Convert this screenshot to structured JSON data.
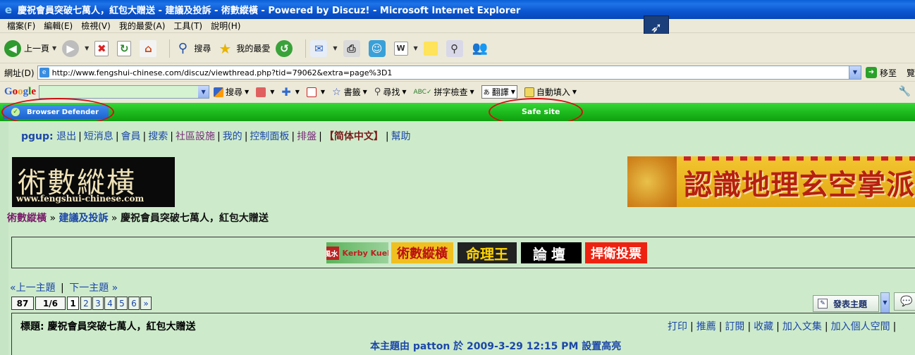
{
  "window": {
    "title": "慶祝會員突破七萬人，紅包大贈送 - 建議及投訴 - 術數縱橫 - Powered by Discuz! - Microsoft Internet Explorer"
  },
  "menu": [
    "檔案(F)",
    "編輯(E)",
    "檢視(V)",
    "我的最愛(A)",
    "工具(T)",
    "說明(H)"
  ],
  "toolbar": {
    "back_label": "上一頁",
    "search_label": "搜尋",
    "favorites_label": "我的最愛"
  },
  "address": {
    "label": "網址(D)",
    "url": "http://www.fengshui-chinese.com/discuz/viewthread.php?tid=79062&extra=page%3D1",
    "go_label": "移至",
    "links_label": "覽"
  },
  "google_bar": {
    "logo": [
      "G",
      "o",
      "o",
      "g",
      "l",
      "e"
    ],
    "search_label": "搜尋",
    "bookmarks_label": "書籤",
    "find_label": "尋找",
    "spell_label": "拼字檢查",
    "translate_label": "翻譯",
    "autofill_label": "自動填入"
  },
  "defender": {
    "button_label": "Browser Defender",
    "status": "Safe site"
  },
  "forum_nav": {
    "user": "pgup:",
    "links": [
      "退出",
      "短消息",
      "會員",
      "搜索",
      "社區設施",
      "我的",
      "控制面板",
      "排盤",
      "【简体中文】",
      "幫助"
    ]
  },
  "logo": {
    "title": "術數縱橫",
    "url": "www.fengshui-chinese.com"
  },
  "banner": {
    "text": "認識地理玄空掌派"
  },
  "breadcrumb": {
    "home": "術數縱橫",
    "section": "建議及投訴",
    "current": "慶祝會員突破七萬人，紅包大贈送"
  },
  "ads": {
    "kerby_cn": "風水",
    "kerby_en": "Kerby Kuek",
    "fengshui": "術數縱橫",
    "mingliwang": "命理王",
    "forum": "論壇",
    "vote": "捍衛投票"
  },
  "thread_nav": {
    "prev": "«上一主題",
    "next": "下一主題 »"
  },
  "pager": {
    "total": "87",
    "fraction": "1/6",
    "current": "1",
    "pages": [
      "2",
      "3",
      "4",
      "5",
      "6",
      "»"
    ]
  },
  "buttons": {
    "new_topic": "發表主題"
  },
  "thread": {
    "subject": "標題: 慶祝會員突破七萬人，紅包大贈送",
    "actions": [
      "打印",
      "推薦",
      "訂閱",
      "收藏",
      "加入文集",
      "加入個人空間"
    ],
    "highlight_note": "本主題由 patton 於 2009-3-29 12:15 PM 設置高亮"
  }
}
